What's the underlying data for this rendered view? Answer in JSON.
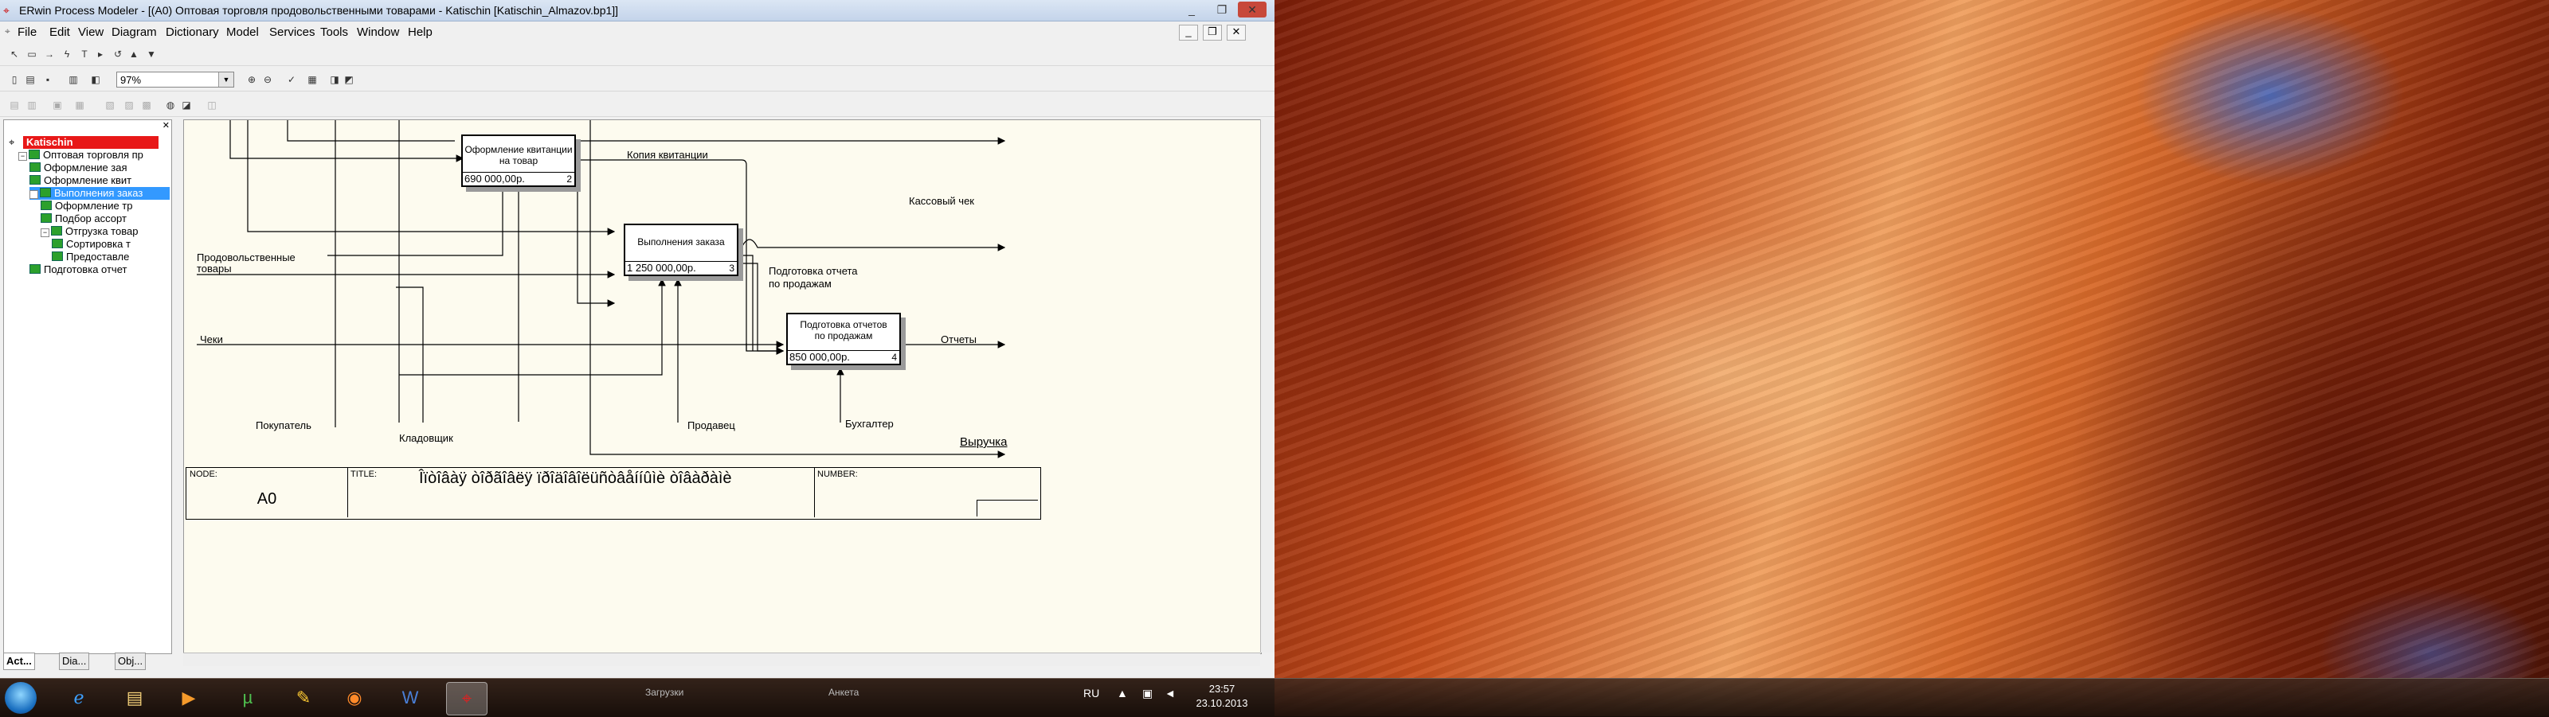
{
  "window": {
    "title": "ERwin Process Modeler - [(A0) Оптовая торговля продовольственными товарами - Katischin  [Katischin_Almazov.bp1]]",
    "controls": {
      "minimize": "_",
      "maximize": "❐",
      "close": "✕"
    }
  },
  "menu": {
    "items": [
      "File",
      "Edit",
      "View",
      "Diagram",
      "Dictionary",
      "Model",
      "Services",
      "Tools",
      "Window",
      "Help"
    ],
    "mdi_controls": {
      "minimize": "_",
      "restore": "❐",
      "close": "✕"
    }
  },
  "toolbar": {
    "zoom": "97%"
  },
  "explorer": {
    "root": "Katischin",
    "items": [
      {
        "label": "Оптовая торговля пр",
        "level": 0,
        "toggle": "⊟"
      },
      {
        "label": "Оформление зая",
        "level": 1
      },
      {
        "label": "Оформление квит",
        "level": 1
      },
      {
        "label": "Выполнения заказ",
        "level": 1,
        "toggle": "⊟",
        "selected": true
      },
      {
        "label": "Оформление тр",
        "level": 2
      },
      {
        "label": "Подбор ассорт",
        "level": 2
      },
      {
        "label": "Отгрузка товар",
        "level": 2,
        "toggle": "⊟"
      },
      {
        "label": "Сортировка т",
        "level": 3
      },
      {
        "label": "Предоставле",
        "level": 3
      },
      {
        "label": "Подготовка отчет",
        "level": 1
      }
    ],
    "tabs": [
      "Act...",
      "Dia...",
      "Obj..."
    ]
  },
  "diagram": {
    "boxes": [
      {
        "name": "Оформление квитанции\nна товар",
        "cost": "690 000,00р.",
        "num": "2"
      },
      {
        "name": "Выполнения заказа",
        "cost": "1 250 000,00р.",
        "num": "3"
      },
      {
        "name": "Подготовка отчетов\nпо продажам",
        "cost": "850 000,00р.",
        "num": "4"
      }
    ],
    "arrows": {
      "copy_receipt": "Копия квитанции",
      "cash_receipt": "Кассовый чек",
      "food_goods": "Продовольственные\nтовары",
      "sales_report": "Подготовка отчета\nпо продажам",
      "checks": "Чеки",
      "reports": "Отчеты",
      "buyer": "Покупатель",
      "storekeeper": "Кладовщик",
      "seller": "Продавец",
      "accountant": "Бухгалтер",
      "revenue": "Выручка"
    },
    "frame": {
      "node_caption": "NODE:",
      "node_value": "A0",
      "title_caption": "TITLE:",
      "title_value": "Îïòîâàÿ òîðãîâëÿ ïðîäîâîëüñòâåííûìè òîâàðàìè",
      "number_caption": "NUMBER:"
    }
  },
  "taskbar": {
    "apps": [
      "windows-explorer",
      "internet-explorer",
      "file-manager",
      "media-player",
      "utorrent",
      "notes",
      "firefox",
      "word",
      "erwin"
    ],
    "language": "RU",
    "time": "23:57",
    "date": "23.10.2013"
  },
  "background_windows": {
    "label_1": "Загрузки",
    "label_2": "Анкета"
  }
}
